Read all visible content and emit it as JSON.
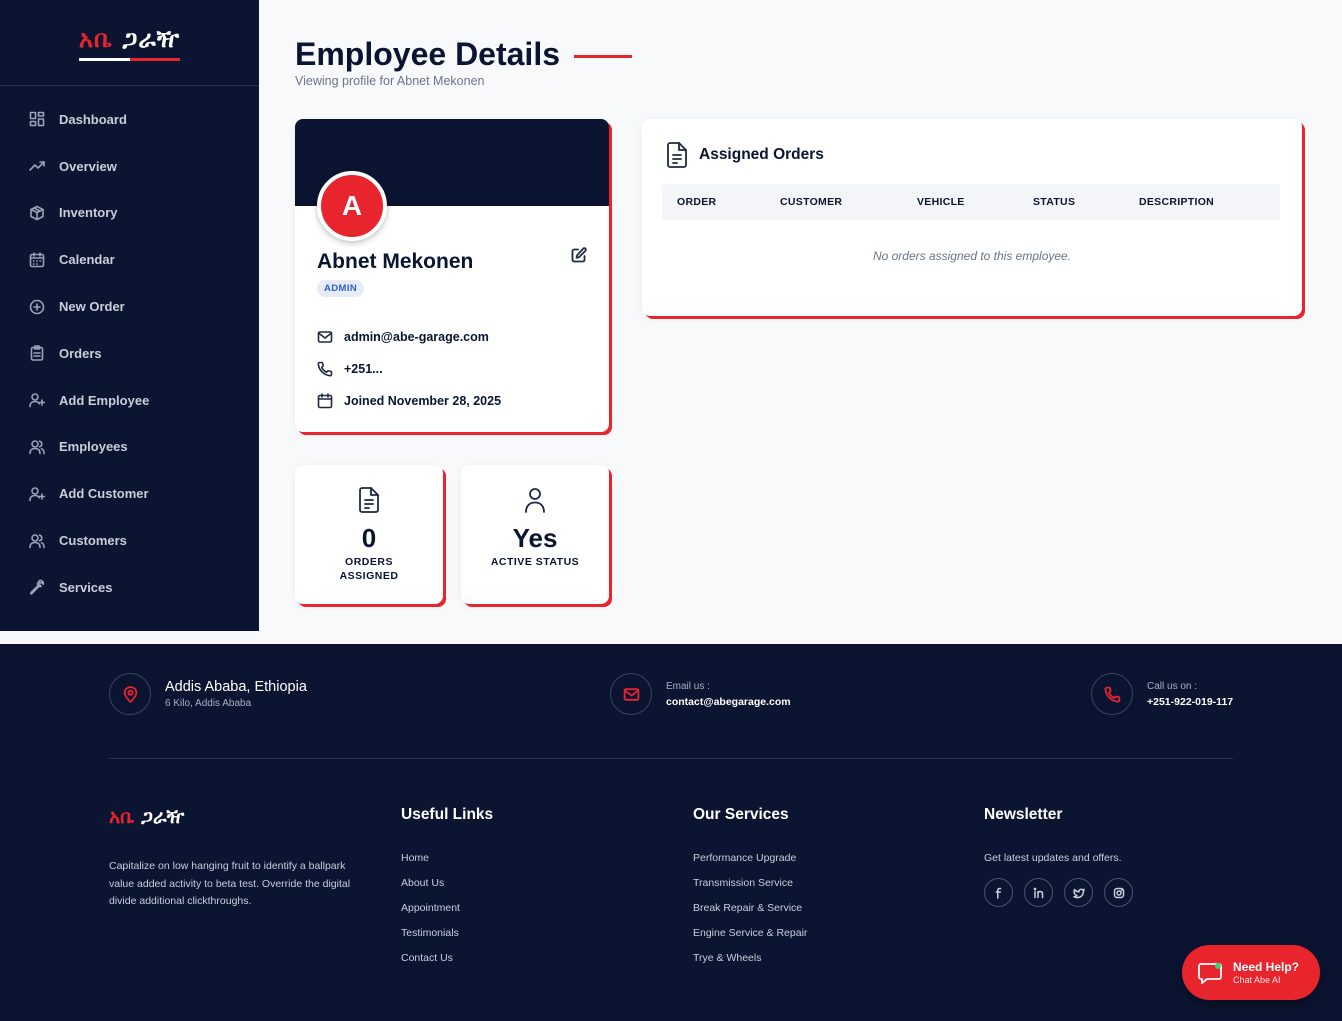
{
  "brand": {
    "logo_white": "አቤ ",
    "logo_red": "ጋራዥ",
    "logo_red_first": "አቤ",
    "logo_white_second": " ጋራዥ"
  },
  "sidebar": {
    "items": [
      {
        "label": "Dashboard",
        "icon": "dashboard-icon"
      },
      {
        "label": "Overview",
        "icon": "trending-up-icon"
      },
      {
        "label": "Inventory",
        "icon": "package-icon"
      },
      {
        "label": "Calendar",
        "icon": "calendar-icon"
      },
      {
        "label": "New Order",
        "icon": "plus-circle-icon"
      },
      {
        "label": "Orders",
        "icon": "clipboard-icon"
      },
      {
        "label": "Add Employee",
        "icon": "user-plus-icon"
      },
      {
        "label": "Employees",
        "icon": "users-icon"
      },
      {
        "label": "Add Customer",
        "icon": "user-plus-icon"
      },
      {
        "label": "Customers",
        "icon": "users-icon"
      },
      {
        "label": "Services",
        "icon": "wrench-icon"
      }
    ]
  },
  "header": {
    "title": "Employee Details",
    "subtitle": "Viewing profile for Abnet Mekonen"
  },
  "profile": {
    "initial": "A",
    "name": "Abnet Mekonen",
    "role": "ADMIN",
    "email": "admin@abe-garage.com",
    "phone": "+251...",
    "joined": "Joined November 28, 2025"
  },
  "stats": {
    "orders_value": "0",
    "orders_label": "ORDERS ASSIGNED",
    "active_value": "Yes",
    "active_label": "ACTIVE STATUS"
  },
  "orders": {
    "title": "Assigned Orders",
    "columns": [
      "ORDER",
      "CUSTOMER",
      "VEHICLE",
      "STATUS",
      "DESCRIPTION"
    ],
    "empty_message": "No orders assigned to this employee."
  },
  "footer": {
    "address_title": "Addis Ababa, Ethiopia",
    "address_sub": "6 Kilo, Addis Ababa",
    "email_label": "Email us :",
    "email_value": "contact@abegarage.com",
    "call_label": "Call us on :",
    "call_value": "+251-922-019-117",
    "description": "Capitalize on low hanging fruit to identify a ballpark value added activity to beta test. Override the digital divide additional clickthroughs.",
    "useful_links_title": "Useful Links",
    "useful_links": [
      "Home",
      "About Us",
      "Appointment",
      "Testimonials",
      "Contact Us"
    ],
    "services_title": "Our Services",
    "services": [
      "Performance Upgrade",
      "Transmission Service",
      "Break Repair & Service",
      "Engine Service & Repair",
      "Trye & Wheels"
    ],
    "newsletter_title": "Newsletter",
    "newsletter_text": "Get latest updates and offers.",
    "socials": [
      "facebook-icon",
      "linkedin-icon",
      "twitter-icon",
      "instagram-icon"
    ]
  },
  "help": {
    "title": "Need Help?",
    "subtitle": "Chat Abe AI"
  },
  "colors": {
    "accent": "#e8242d",
    "navy": "#0b1430",
    "background": "#f8f9fb"
  }
}
